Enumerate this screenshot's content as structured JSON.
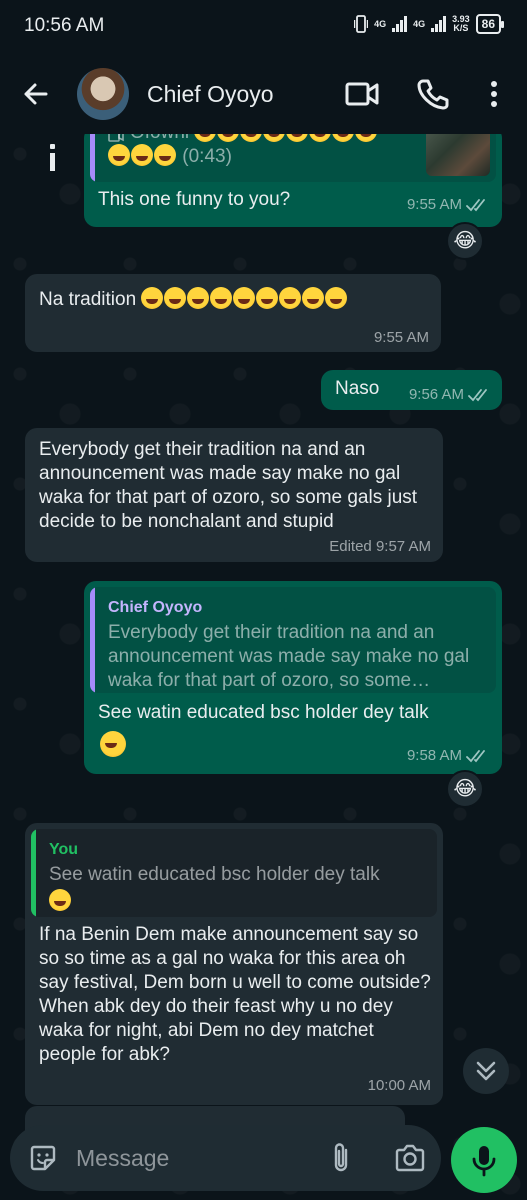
{
  "status_bar": {
    "time": "10:56 AM",
    "net1": "4G",
    "net2": "4G",
    "speed_value": "3.93",
    "speed_unit": "K/S",
    "battery": "86"
  },
  "header": {
    "contact_name": "Chief Oyoyo"
  },
  "messages": [
    {
      "id": "m1",
      "direction": "out",
      "quote_line1": "Ofowhi",
      "quote_line2": "(0:43)",
      "text": "This one funny to you?",
      "time": "9:55 AM",
      "reaction": "😂"
    },
    {
      "id": "m2",
      "direction": "in",
      "text": "Na tradition",
      "emoji_count": 9,
      "time": "9:55 AM"
    },
    {
      "id": "m3",
      "direction": "out",
      "text": "Naso",
      "time": "9:56 AM"
    },
    {
      "id": "m4",
      "direction": "in",
      "text": "Everybody get their tradition na and an announcement was made say make no gal waka for that part of ozoro, so some gals just decide to be nonchalant and stupid",
      "edited_label": "Edited",
      "time": "9:57 AM"
    },
    {
      "id": "m5",
      "direction": "out",
      "quote_author": "Chief Oyoyo",
      "quote_text": "Everybody get their tradition na and an announcement was made say make no gal waka for that part of ozoro, so some…",
      "text": "See watin educated bsc holder dey talk",
      "time": "9:58 AM",
      "reaction": "😂"
    },
    {
      "id": "m6",
      "direction": "in",
      "quote_author": "You",
      "quote_text": "See watin educated bsc holder dey talk",
      "text": "If na Benin Dem make announcement say so so so time as a gal no waka for this area oh say festival, Dem born u well to come outside?\nWhen abk dey do their feast why u no dey waka for night, abi Dem no dey matchet people for abk?",
      "time": "10:00 AM"
    }
  ],
  "composer": {
    "placeholder": "Message"
  },
  "colors": {
    "background": "#0b141a",
    "outgoing_bubble": "#005c4b",
    "incoming_bubble": "#202c33",
    "accent_green": "#21c063",
    "quote_bar_contact": "#a78bfa",
    "quote_bar_you": "#21c063",
    "tick_read": "#9ec6c2"
  },
  "icons": [
    "back-arrow-icon",
    "video-call-icon",
    "phone-icon",
    "more-vert-icon",
    "sticker-icon",
    "attach-icon",
    "camera-icon",
    "mic-icon",
    "chevron-double-down-icon",
    "video-icon"
  ]
}
